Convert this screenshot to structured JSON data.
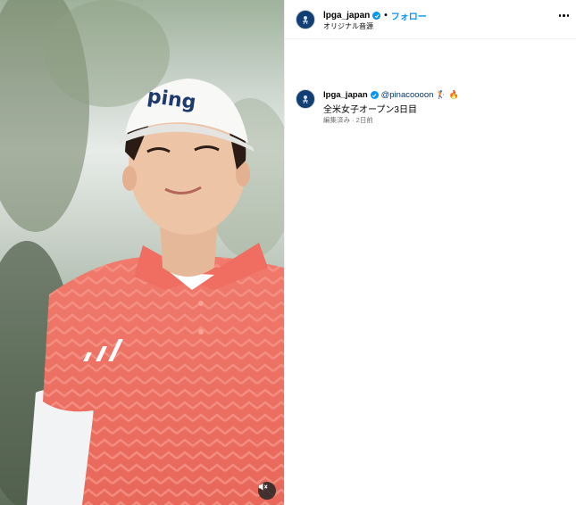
{
  "header": {
    "username": "lpga_japan",
    "separator": "•",
    "follow_label": "フォロー",
    "audio_label": "オリジナル音源"
  },
  "caption": {
    "username": "lpga_japan",
    "mention": "@pinacoooon",
    "emoji_golfer": "🏌",
    "emoji_fire": "🔥",
    "text": "全米女子オープン3日目",
    "meta": "編集済み · 2日前"
  },
  "media": {
    "description_icon": "video-mute-icon"
  },
  "colors": {
    "follow_blue": "#0095f6",
    "verified_blue": "#0095f6",
    "avatar_navy": "#0f3f74",
    "shirt_coral": "#ef6f63"
  }
}
